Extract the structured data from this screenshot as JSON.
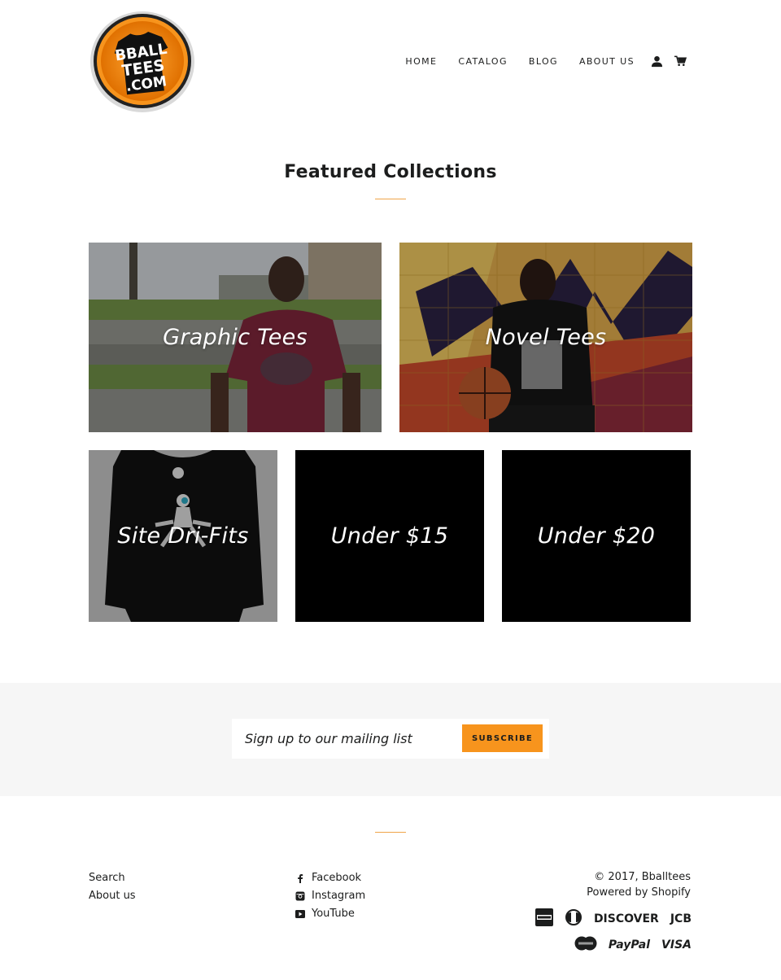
{
  "header": {
    "logo": {
      "text_lines": [
        "BBALL",
        "TEES",
        ".COM"
      ],
      "colors": {
        "ring": "#f7941d",
        "inner": "#f07f0a",
        "shirt": "#111111"
      }
    },
    "nav": [
      {
        "label": "HOME"
      },
      {
        "label": "CATALOG"
      },
      {
        "label": "BLOG"
      },
      {
        "label": "ABOUT US"
      }
    ],
    "icons": [
      "account-icon",
      "cart-icon"
    ]
  },
  "featured": {
    "title": "Featured Collections",
    "collections": [
      {
        "label": "Graphic Tees"
      },
      {
        "label": "Novel Tees"
      },
      {
        "label": "Site Dri-Fits"
      },
      {
        "label": "Under $15"
      },
      {
        "label": "Under $20"
      }
    ]
  },
  "newsletter": {
    "placeholder": "Sign up to our mailing list",
    "button": "SUBSCRIBE",
    "accent": "#f7941d"
  },
  "footer": {
    "links": [
      {
        "label": "Search"
      },
      {
        "label": "About us"
      }
    ],
    "social": [
      {
        "label": "Facebook",
        "icon": "facebook-icon"
      },
      {
        "label": "Instagram",
        "icon": "instagram-icon"
      },
      {
        "label": "YouTube",
        "icon": "youtube-icon"
      }
    ],
    "copyright": "© 2017, Bballtees",
    "powered": "Powered by Shopify",
    "payments": {
      "row1": [
        "american-express",
        "diners-club",
        "DISCOVER",
        "JCB"
      ],
      "row2": [
        "master",
        "PayPal",
        "VISA"
      ]
    }
  }
}
